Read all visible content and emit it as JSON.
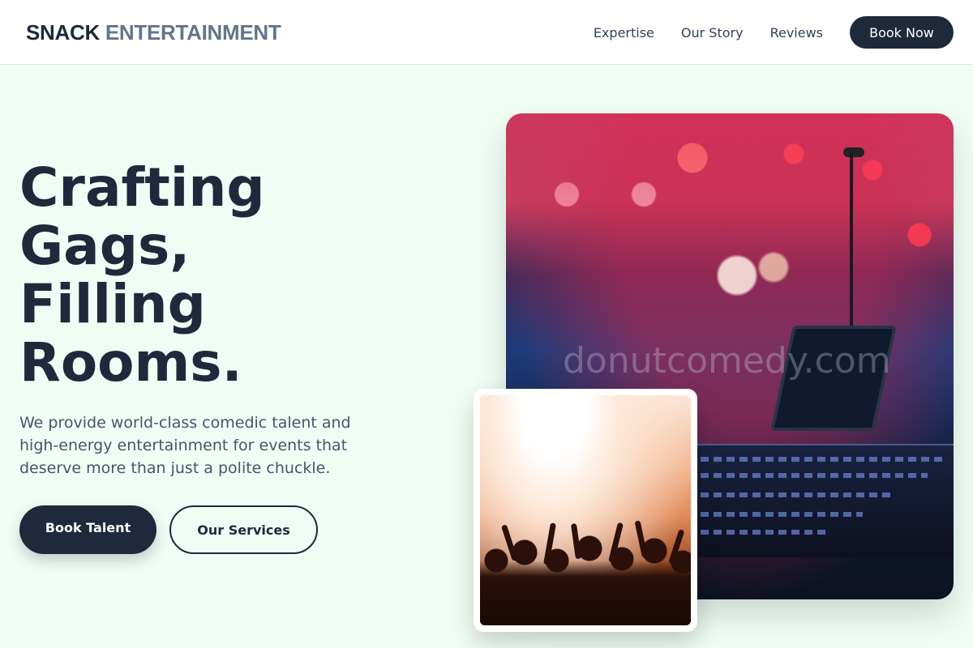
{
  "header": {
    "logo_part1": "SNACK",
    "logo_part2": "ENTERTAINMENT",
    "nav": [
      "Expertise",
      "Our Story",
      "Reviews"
    ],
    "cta": "Book Now"
  },
  "hero": {
    "title_lines": [
      "Crafting",
      "Gags,",
      "Filling",
      "Rooms."
    ],
    "description": "We provide world-class comedic talent and high-energy entertainment for events that deserve more than just a polite chuckle.",
    "primary_button": "Book Talent",
    "secondary_button": "Our Services"
  },
  "images": {
    "main_watermark": "donutcomedy.com"
  },
  "colors": {
    "primary": "#1e293b",
    "muted": "#64748b",
    "background": "#f0fdf4"
  }
}
